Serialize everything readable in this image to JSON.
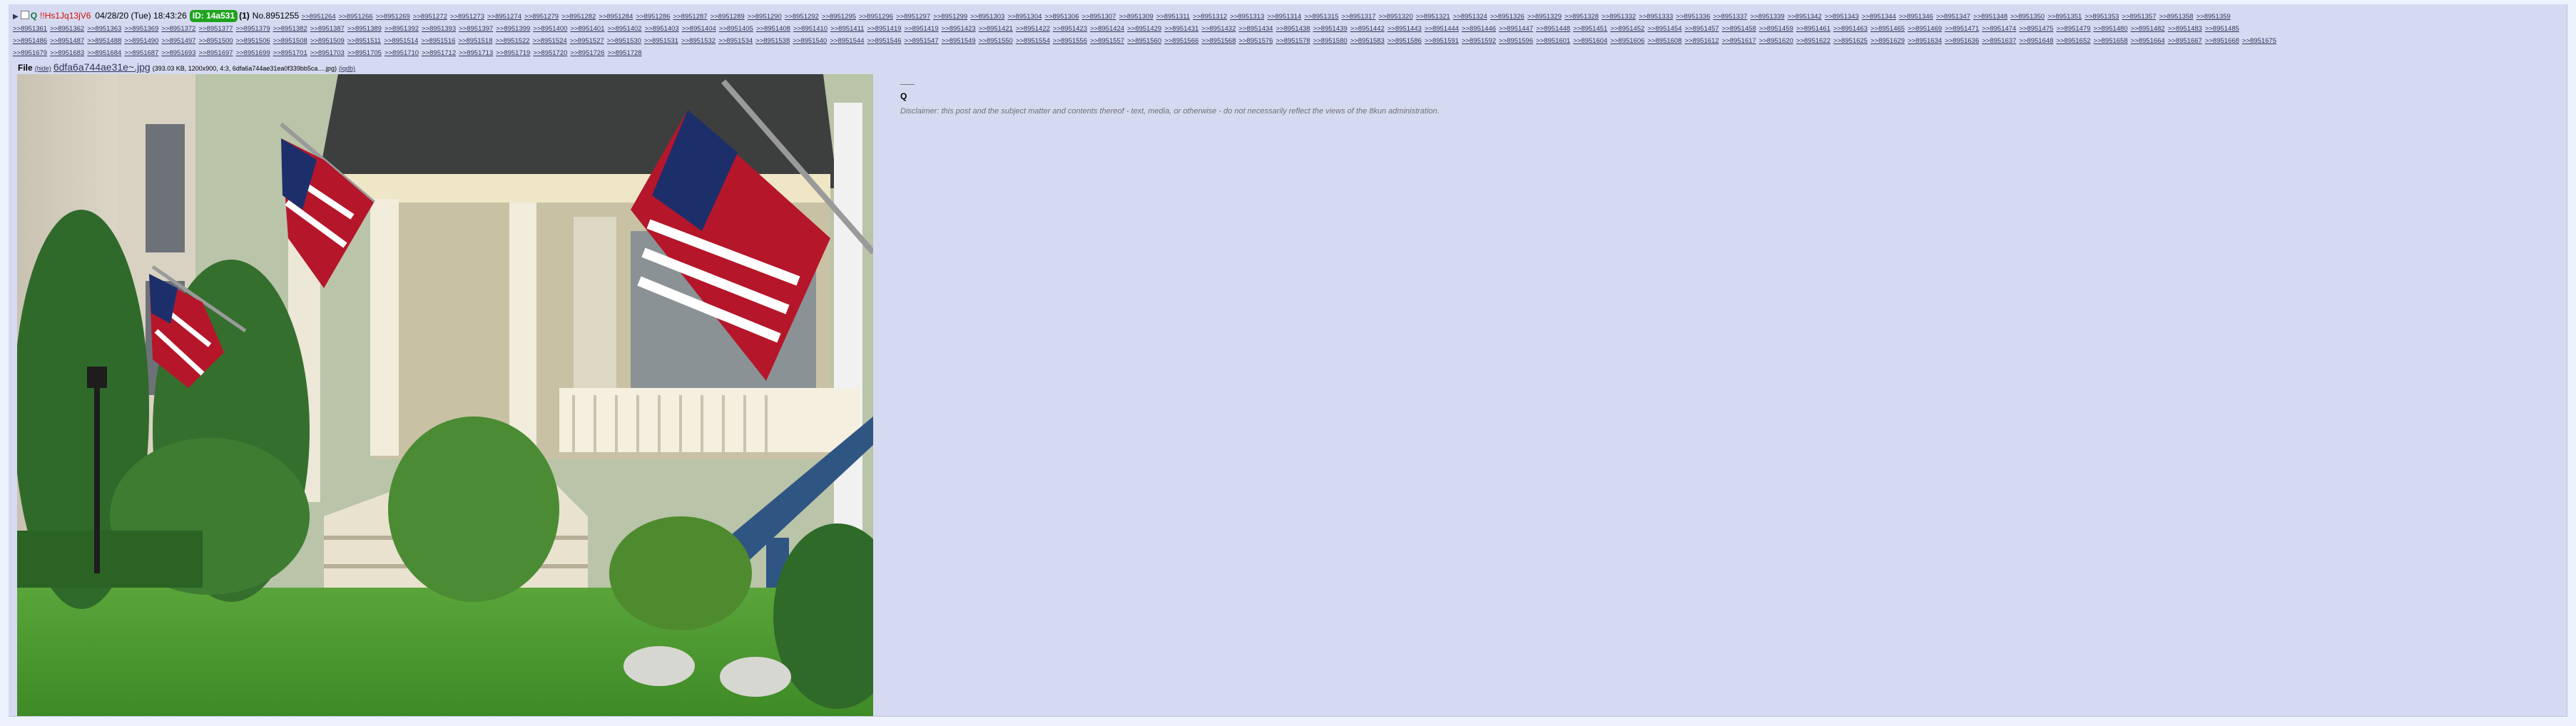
{
  "header": {
    "arrow": "▶",
    "name": "Q",
    "tripcode": "!!Hs1Jq13jV6",
    "date": "04/28/20 (Tue) 18:43:26",
    "id_label": "ID: 14a531",
    "id_count": "(1)",
    "post_number": "No.8951255"
  },
  "replies_rows": [
    [
      ">>8951264",
      ">>8951266",
      ">>8951269",
      ">>8951272",
      ">>8951273",
      ">>8951274",
      ">>8951279",
      ">>8951282",
      ">>8951284",
      ">>8951286",
      ">>8951287",
      ">>8951289",
      ">>8951290",
      ">>8951292",
      ">>8951295",
      ">>8951296",
      ">>8951297",
      ">>8951299",
      ">>8951303",
      ">>8951304",
      ">>8951306",
      ">>8951307",
      ">>8951309",
      ">>8951311",
      ">>8951312",
      ">>8951313",
      ">>8951314",
      ">>8951315",
      ">>8951317",
      ">>8951320",
      ">>8951321",
      ">>8951324",
      ">>8951326",
      ">>8951329",
      ">>8951328",
      ">>8951332",
      ">>8951333",
      ">>8951336",
      ">>8951337",
      ">>8951339",
      ">>8951342",
      ">>8951343",
      ">>8951344",
      ">>8951346",
      ">>8951347",
      ">>8951348",
      ">>8951350",
      ">>8951351",
      ">>8951353",
      ">>8951357",
      ">>8951358",
      ">>8951359"
    ],
    [
      ">>8951361",
      ">>8951362",
      ">>8951363",
      ">>8951369",
      ">>8951372",
      ">>8951377",
      ">>8951379",
      ">>8951382",
      ">>8951387",
      ">>8951389",
      ">>8951392",
      ">>8951393",
      ">>8951397",
      ">>8951399",
      ">>8951400",
      ">>8951401",
      ">>8951402",
      ">>8951403",
      ">>8951404",
      ">>8951405",
      ">>8951408",
      ">>8951410",
      ">>8951411",
      ">>8951419",
      ">>8951419",
      ">>8951423",
      ">>8951421",
      ">>8951422",
      ">>8951423",
      ">>8951424",
      ">>8951429",
      ">>8951431",
      ">>8951432",
      ">>8951434",
      ">>8951438",
      ">>8951439",
      ">>8951442",
      ">>8951443",
      ">>8951444",
      ">>8951446",
      ">>8951447",
      ">>8951448",
      ">>8951451",
      ">>8951452",
      ">>8951454",
      ">>8951457",
      ">>8951458",
      ">>8951459",
      ">>8951461",
      ">>8951463",
      ">>8951465",
      ">>8951469",
      ">>8951471",
      ">>8951474",
      ">>8951475",
      ">>8951479",
      ">>8951480",
      ">>8951482",
      ">>8951483",
      ">>8951485"
    ],
    [
      ">>8951486",
      ">>8951487",
      ">>8951488",
      ">>8951490",
      ">>8951497",
      ">>8951500",
      ">>8951506",
      ">>8951508",
      ">>8951509",
      ">>8951511",
      ">>8951514",
      ">>8951516",
      ">>8951518",
      ">>8951522",
      ">>8951524",
      ">>8951527",
      ">>8951530",
      ">>8951531",
      ">>8951532",
      ">>8951534",
      ">>8951538",
      ">>8951540",
      ">>8951544",
      ">>8951546",
      ">>8951547",
      ">>8951549",
      ">>8951550",
      ">>8951554",
      ">>8951556",
      ">>8951557",
      ">>8951560",
      ">>8951566",
      ">>8951568",
      ">>8951576",
      ">>8951578",
      ">>8951580",
      ">>8951583",
      ">>8951586",
      ">>8951591",
      ">>8951592",
      ">>8951596",
      ">>8951601",
      ">>8951604",
      ">>8951606",
      ">>8951608",
      ">>8951612",
      ">>8951617",
      ">>8951620",
      ">>8951622",
      ">>8951625",
      ">>8951629",
      ">>8951634",
      ">>8951636",
      ">>8951637",
      ">>8951648",
      ">>8951652",
      ">>8951658",
      ">>8951664",
      ">>8951667",
      ">>8951668",
      ">>8951675"
    ],
    [
      ">>8951679",
      ">>8951683",
      ">>8951684",
      ">>8951687",
      ">>8951693",
      ">>8951697",
      ">>8951699",
      ">>8951701",
      ">>8951703",
      ">>8951705",
      ">>8951710",
      ">>8951712",
      ">>8951713",
      ">>8951719",
      ">>8951720",
      ">>8951726",
      ">>8951728"
    ]
  ],
  "file": {
    "label": "File",
    "hide": "(hide)",
    "filename": "6dfa6a744ae31e~.jpg",
    "meta": "(393.03 KB, 1200x900, 4:3, 6dfa6a744ae31ea0f339bb5ca….jpg)",
    "iqdb": "(iqdb)"
  },
  "body": {
    "line1": "___",
    "line2": "Q",
    "disclaimer": "Disclaimer: this post and the subject matter and contents thereof - text, media, or otherwise - do not necessarily reflect the views of the 8kun administration."
  }
}
